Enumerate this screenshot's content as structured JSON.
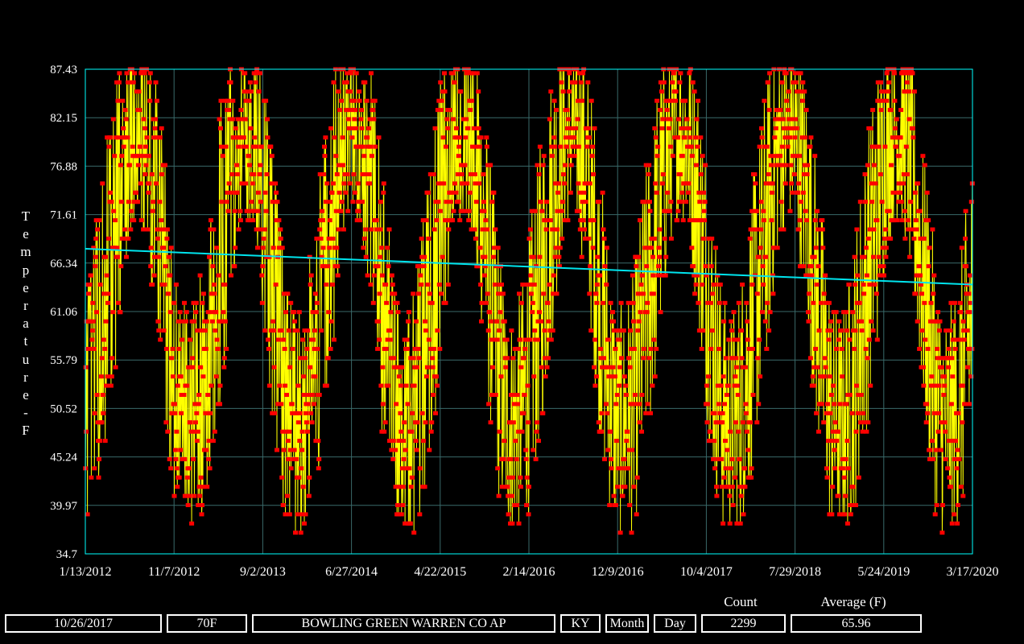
{
  "chart_data": {
    "type": "line",
    "ylabel": "Temperature-F",
    "ylim": [
      34.7,
      87.43
    ],
    "y_ticks": [
      "87.43",
      "82.15",
      "76.88",
      "71.61",
      "66.34",
      "61.06",
      "55.79",
      "50.52",
      "45.24",
      "39.97",
      "34.7"
    ],
    "x_ticks": [
      "1/13/2012",
      "11/7/2012",
      "9/2/2013",
      "6/27/2014",
      "4/22/2015",
      "2/14/2016",
      "12/9/2016",
      "10/4/2017",
      "7/29/2018",
      "5/24/2019",
      "3/17/2020"
    ],
    "x_range": [
      "2012-01-13",
      "2020-03-17"
    ],
    "trend": {
      "start": [
        "2012-01-13",
        67.9
      ],
      "end": [
        "2020-03-17",
        64.0
      ]
    },
    "series": [
      {
        "marker_color": "#ff0000",
        "line_color": "#ffff00",
        "seasonal_min_by_month": [
          40,
          41,
          46,
          53,
          61,
          70,
          74,
          72,
          65,
          54,
          45,
          40
        ],
        "seasonal_max_by_month": [
          58,
          62,
          70,
          77,
          84,
          87.43,
          87.43,
          87.43,
          84,
          76,
          67,
          59
        ],
        "sample_count": 2299
      }
    ],
    "colors": {
      "background": "#000000",
      "plot_frame": "#00ffff",
      "grid": "#3a6a6a",
      "trend": "#00e5ee"
    }
  },
  "footer": {
    "date": "10/26/2017",
    "temp": "70F",
    "station": "BOWLING GREEN WARREN CO AP",
    "state": "KY",
    "month_btn": "Month",
    "day_btn": "Day",
    "count_label": "Count",
    "count": "2299",
    "average_label": "Average (F)",
    "average": "65.96"
  }
}
